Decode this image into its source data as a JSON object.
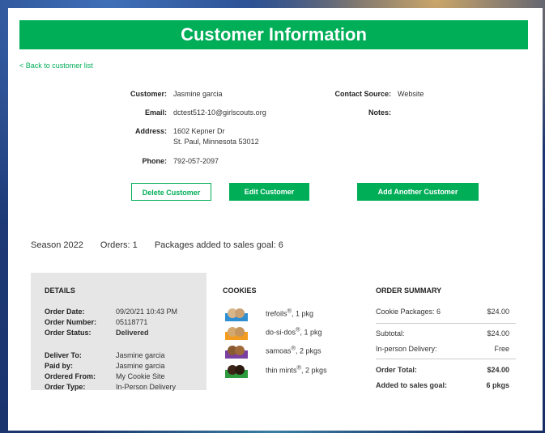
{
  "title": "Customer Information",
  "back_link": "< Back to customer list",
  "customer": {
    "customer_label": "Customer:",
    "customer_value": "Jasmine garcia",
    "email_label": "Email:",
    "email_value": "dctest512-10@girlscouts.org",
    "address_label": "Address:",
    "address_line1": "1602 Kepner Dr",
    "address_line2": "St. Paul, Minnesota 53012",
    "phone_label": "Phone:",
    "phone_value": "792-057-2097",
    "contact_source_label": "Contact Source:",
    "contact_source_value": "Website",
    "notes_label": "Notes:"
  },
  "buttons": {
    "delete": "Delete Customer",
    "edit": "Edit Customer",
    "add_another": "Add Another Customer"
  },
  "season": {
    "season": "Season 2022",
    "orders": "Orders: 1",
    "packages": "Packages added to sales goal: 6"
  },
  "details": {
    "heading": "DETAILS",
    "order_date_label": "Order Date:",
    "order_date": "09/20/21 10:43 PM",
    "order_number_label": "Order Number:",
    "order_number": "05118771",
    "order_status_label": "Order Status:",
    "order_status": "Delivered",
    "deliver_to_label": "Deliver To:",
    "deliver_to": "Jasmine garcia",
    "paid_by_label": "Paid by:",
    "paid_by": "Jasmine garcia",
    "ordered_from_label": "Ordered From:",
    "ordered_from": "My Cookie Site",
    "order_type_label": "Order Type:",
    "order_type": "In-Person Delivery"
  },
  "cookies": {
    "heading": "COOKIES",
    "items": [
      {
        "name": "trefoils",
        "qty": ", 1 pkg",
        "color": "#2f8fd1"
      },
      {
        "name": "do-si-dos",
        "qty": ", 1 pkg",
        "color": "#f39c1f"
      },
      {
        "name": "samoas",
        "qty": ", 2 pkgs",
        "color": "#7a3fa0"
      },
      {
        "name": "thin mints",
        "qty": ", 2 pkgs",
        "color": "#2e9b3e"
      }
    ]
  },
  "order_summary": {
    "heading": "ORDER SUMMARY",
    "cookie_packages_label": "Cookie Packages: 6",
    "cookie_packages_value": "$24.00",
    "subtotal_label": "Subtotal:",
    "subtotal_value": "$24.00",
    "delivery_label": "In-person Delivery:",
    "delivery_value": "Free",
    "total_label": "Order Total:",
    "total_value": "$24.00",
    "goal_label": "Added to sales goal:",
    "goal_value": "6 pkgs"
  },
  "colors": {
    "brand_green": "#00ae58"
  }
}
